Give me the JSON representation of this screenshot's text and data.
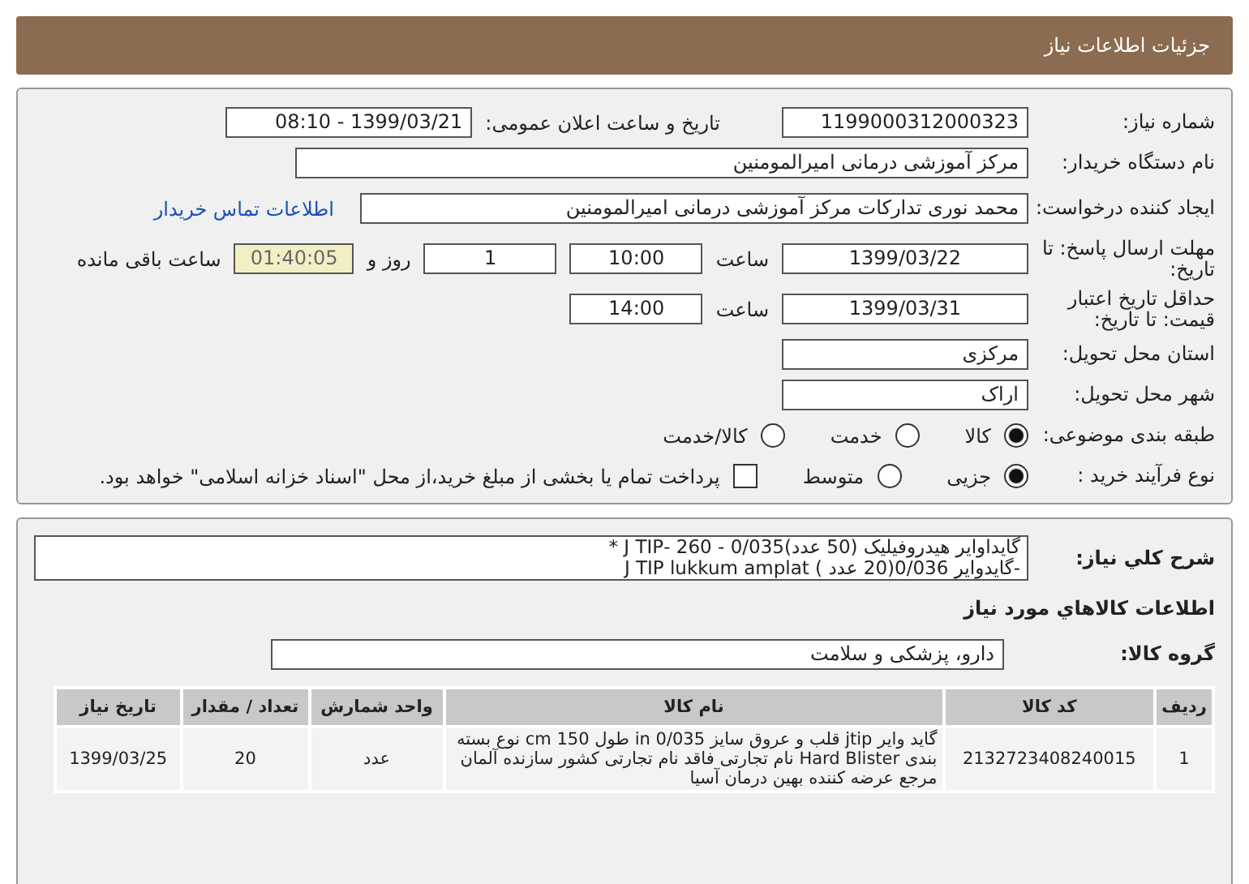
{
  "header": {
    "title": "جزئیات اطلاعات نیاز"
  },
  "details": {
    "need_number": {
      "label": "شماره نیاز:",
      "value": "1199000312000323"
    },
    "announce": {
      "label": "تاریخ و ساعت اعلان عمومی:",
      "value": "1399/03/21 - 08:10"
    },
    "buyer": {
      "label": "نام دستگاه خریدار:",
      "value": "مرکز آموزشی  درمانی امیرالمومنین"
    },
    "creator": {
      "label": "ایجاد کننده درخواست:",
      "value": "محمد نوری تدارکات مرکز آموزشی  درمانی امیرالمومنین",
      "link": "اطلاعات تماس خریدار"
    },
    "deadline": {
      "label": "مهلت ارسال پاسخ: تا تاریخ:",
      "date": "1399/03/22",
      "time_label": "ساعت",
      "time": "10:00",
      "days": "1",
      "days_label": "روز و",
      "remaining": "01:40:05",
      "remaining_label": "ساعت باقی مانده"
    },
    "validity": {
      "label": "حداقل تاریخ اعتبار قیمت: تا تاریخ:",
      "date": "1399/03/31",
      "time_label": "ساعت",
      "time": "14:00"
    },
    "province": {
      "label": "استان محل تحویل:",
      "value": "مرکزی"
    },
    "city": {
      "label": "شهر محل تحویل:",
      "value": "اراک"
    },
    "category": {
      "label": "طبقه بندی موضوعی:",
      "options": [
        {
          "label": "کالا",
          "selected": true
        },
        {
          "label": "خدمت",
          "selected": false
        },
        {
          "label": "کالا/خدمت",
          "selected": false
        }
      ]
    },
    "process": {
      "label": "نوع فرآیند خرید :",
      "options": [
        {
          "label": "جزیی",
          "selected": true
        },
        {
          "label": "متوسط",
          "selected": false
        }
      ],
      "payment": {
        "label": "پرداخت تمام یا بخشی از مبلغ خرید،از محل \"اسناد خزانه اسلامی\" خواهد بود.",
        "checked": false
      }
    }
  },
  "description": {
    "label": "شرح کلي نياز:",
    "lines": [
      "گایداوایر  هیدروفیلیک (50 عدد)0/035 - 260 -J TIP *",
      "-گایدوایر 0/036(20 عدد ) J TIP lukkum amplat"
    ]
  },
  "goods": {
    "title": "اطلاعات کالاهاي مورد نياز",
    "group_label": "گروه کالا:",
    "group": "دارو، پزشکی و سلامت",
    "table": {
      "columns": [
        "رديف",
        "کد کالا",
        "نام کالا",
        "واحد شمارش",
        "تعداد / مقدار",
        "تاریخ نیاز"
      ],
      "rows": [
        [
          "1",
          "2132723408240015",
          "گاید وایر jtip قلب و عروق سایز in 0/035 طول cm 150 نوع بسته بندی Hard Blister نام تجارتی فاقد نام تجارتی کشور سازنده آلمان مرجع عرضه کننده بهین درمان آسیا",
          "عدد",
          "20",
          "1399/03/25"
        ]
      ]
    }
  }
}
